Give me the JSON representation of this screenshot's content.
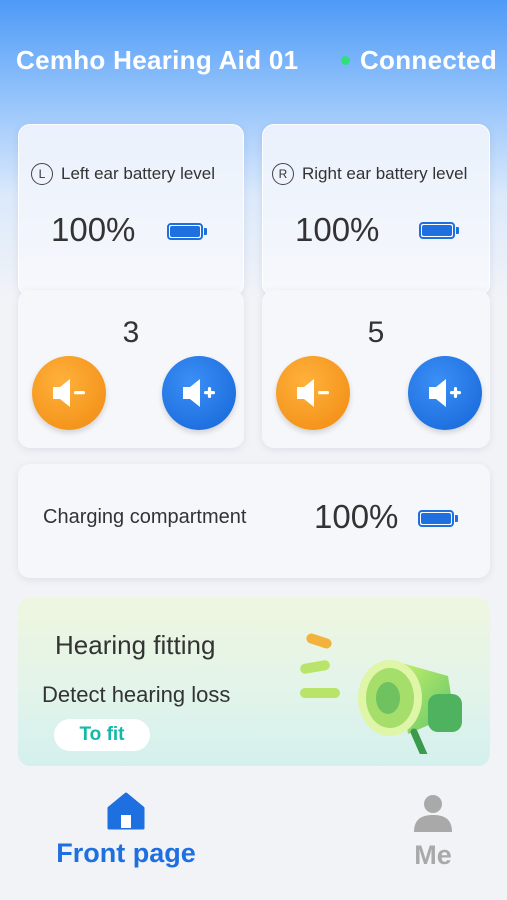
{
  "header": {
    "device_name": "Cemho Hearing Aid 01",
    "status": "Connected",
    "status_color": "#2fe07a"
  },
  "left_ear": {
    "badge": "L",
    "title": "Left ear battery level",
    "battery_percent": "100%",
    "battery_level": 1.0,
    "volume": "3"
  },
  "right_ear": {
    "badge": "R",
    "title": "Right ear battery level",
    "battery_percent": "100%",
    "battery_level": 1.0,
    "volume": "5"
  },
  "charging": {
    "label": "Charging compartment",
    "battery_percent": "100%",
    "battery_level": 1.0
  },
  "fitting": {
    "title": "Hearing fitting",
    "subtitle": "Detect hearing loss",
    "button_label": "To fit"
  },
  "tabbar": {
    "home_label": "Front page",
    "me_label": "Me"
  },
  "colors": {
    "accent_blue": "#1e6fe0",
    "volume_down_orange": "#f08a10",
    "fit_button_text": "#13b8a8",
    "inactive_tab": "#a9a9a9"
  },
  "icons": {
    "battery": "battery-icon",
    "volume_down": "volume-down-icon",
    "volume_up": "volume-up-icon",
    "megaphone": "megaphone-icon",
    "home": "home-icon",
    "profile": "person-icon"
  }
}
